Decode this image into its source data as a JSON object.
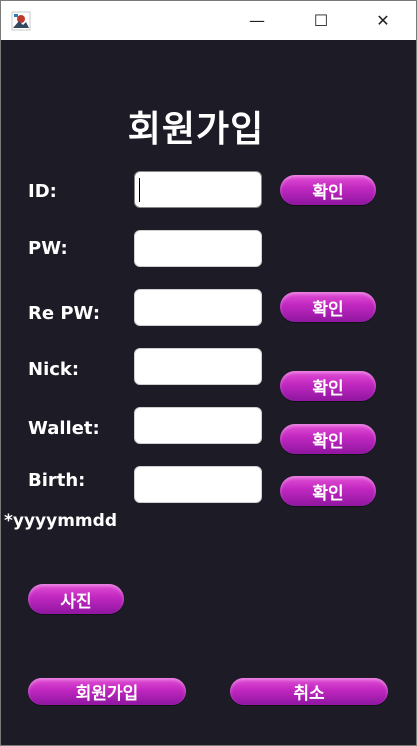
{
  "window": {
    "minimize_glyph": "—",
    "maximize_glyph": "☐",
    "close_glyph": "✕"
  },
  "form": {
    "title": "회원가입",
    "fields": [
      {
        "label": "ID:",
        "value": ""
      },
      {
        "label": "PW:",
        "value": ""
      },
      {
        "label": "Re PW:",
        "value": ""
      },
      {
        "label": "Nick:",
        "value": ""
      },
      {
        "label": "Wallet:",
        "value": ""
      },
      {
        "label": "Birth:",
        "value": ""
      }
    ],
    "birth_hint": "*yyyymmdd",
    "confirm_label": "확인",
    "photo_label": "사진",
    "signup_label": "회원가입",
    "cancel_label": "취소"
  },
  "colors": {
    "background": "#1c1b26",
    "button_gradient_top": "#e34fd6",
    "button_gradient_bottom": "#8e16a0"
  },
  "icons": [
    "app-icon",
    "minimize-icon",
    "maximize-icon",
    "close-icon"
  ]
}
